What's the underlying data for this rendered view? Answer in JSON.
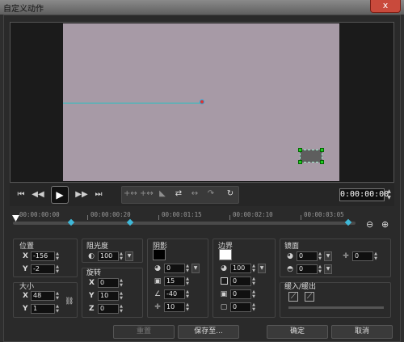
{
  "window": {
    "title": "自定义动作",
    "close": "x"
  },
  "preview": {},
  "transport": {
    "first": "⏮",
    "prev": "◀◀",
    "play": "▶",
    "next": "▶▶",
    "last": "⏭",
    "timecode": "0:00:00:00",
    "spin_up": "▲",
    "spin_down": "▼"
  },
  "tools": [
    "+↔",
    "+↔",
    "◣",
    "⇄",
    "↔",
    "↷",
    "↻"
  ],
  "timeline": {
    "labels": [
      "00:00:00:00",
      "00:00:00:20",
      "00:00:01:15",
      "00:00:02:10",
      "00:00:03:05"
    ],
    "zoom_out": "⊖",
    "zoom_in": "⊕"
  },
  "position": {
    "label": "位置",
    "x_label": "X",
    "x": "-156",
    "y_label": "Y",
    "y": "-2"
  },
  "size": {
    "label": "大小",
    "x_label": "X",
    "x": "48",
    "y_label": "Y",
    "y": "1"
  },
  "opacity": {
    "label": "阻光度",
    "value": "100"
  },
  "rotation": {
    "label": "旋转",
    "x_label": "X",
    "x": "0",
    "y_label": "Y",
    "y": "10",
    "z_label": "Z",
    "z": "0"
  },
  "shadow": {
    "label": "阴影",
    "v1": "0",
    "v2": "15",
    "v3": "-40",
    "v4": "10",
    "color": "#000000"
  },
  "border": {
    "label": "边界",
    "v1": "100",
    "v2": "0",
    "v3": "0",
    "v4": "0",
    "color": "#ffffff"
  },
  "mirror": {
    "label": "镜面",
    "v1": "0",
    "v2": "0",
    "v3": "0"
  },
  "fade": {
    "label": "缓入/缓出"
  },
  "buttons": {
    "reset": "重置",
    "save_to": "保存至...",
    "ok": "确定",
    "cancel": "取消"
  }
}
